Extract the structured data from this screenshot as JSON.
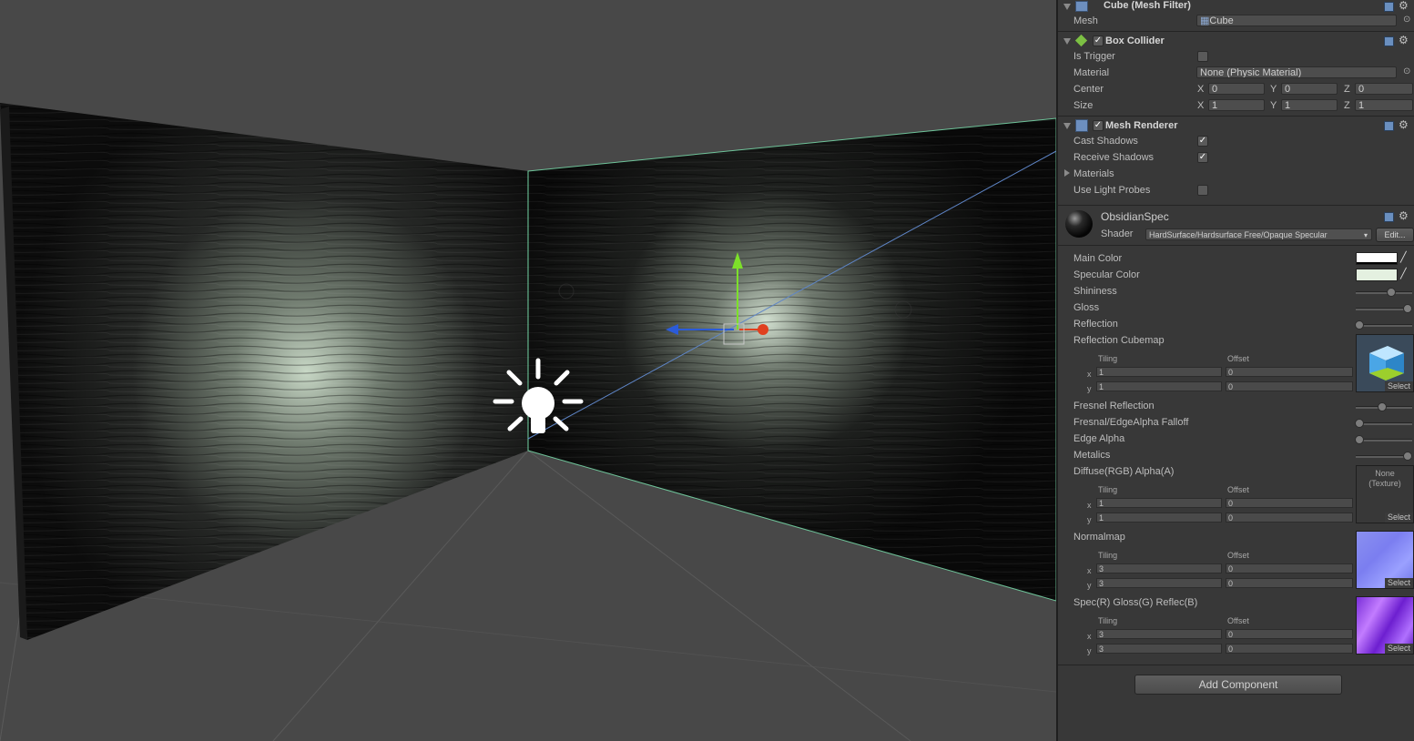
{
  "mesh_filter": {
    "title": "Cube (Mesh Filter)",
    "mesh_label": "Mesh",
    "mesh_value": "Cube"
  },
  "box_collider": {
    "title": "Box Collider",
    "is_trigger_label": "Is Trigger",
    "material_label": "Material",
    "material_value": "None (Physic Material)",
    "center_label": "Center",
    "size_label": "Size",
    "axis_x": "X",
    "axis_y": "Y",
    "axis_z": "Z",
    "center": {
      "x": "0",
      "y": "0",
      "z": "0"
    },
    "size": {
      "x": "1",
      "y": "1",
      "z": "1"
    }
  },
  "mesh_renderer": {
    "title": "Mesh Renderer",
    "cast_shadows_label": "Cast Shadows",
    "receive_shadows_label": "Receive Shadows",
    "materials_label": "Materials",
    "light_probes_label": "Use Light Probes"
  },
  "material": {
    "name": "ObsidianSpec",
    "shader_label": "Shader",
    "shader_value": "HardSurface/Hardsurface Free/Opaque Specular",
    "edit_label": "Edit...",
    "main_color_label": "Main Color",
    "specular_color_label": "Specular Color",
    "shininess_label": "Shininess",
    "gloss_label": "Gloss",
    "reflection_label": "Reflection",
    "cubemap_label": "Reflection Cubemap",
    "fresnel_label": "Fresnel Reflection",
    "falloff_label": "Fresnal/EdgeAlpha Falloff",
    "edge_alpha_label": "Edge Alpha",
    "metalics_label": "Metalics",
    "diffuse_label": "Diffuse(RGB) Alpha(A)",
    "normalmap_label": "Normalmap",
    "spec_label": "Spec(R) Gloss(G) Reflec(B)",
    "tiling_label": "Tiling",
    "offset_label": "Offset",
    "x_label": "x",
    "y_label": "y",
    "select_label": "Select",
    "none_texture": "None (Texture)",
    "cubemap_tiling": {
      "x": "1",
      "y": "1",
      "ox": "0",
      "oy": "0"
    },
    "diffuse_tiling": {
      "x": "1",
      "y": "1",
      "ox": "0",
      "oy": "0"
    },
    "normal_tiling": {
      "x": "3",
      "y": "3",
      "ox": "0",
      "oy": "0"
    },
    "spec_tiling": {
      "x": "3",
      "y": "3",
      "ox": "0",
      "oy": "0"
    },
    "sliders": {
      "shininess": 0.62,
      "gloss": 0.95,
      "reflection": 0.0,
      "fresnel": 0.45,
      "falloff": 0.0,
      "edge_alpha": 0.0,
      "metalics": 0.95
    },
    "main_color": "#ffffff",
    "specular_color": "#e4f0e0"
  },
  "add_component_label": "Add Component",
  "colors": {
    "panel_bg": "#383838",
    "scene_bg": "#4a4a4a",
    "gizmo_y": "#7de02a",
    "gizmo_x": "#e0401f",
    "gizmo_z": "#2b5bd8"
  }
}
